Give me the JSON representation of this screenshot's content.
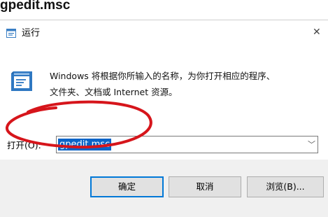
{
  "caption": "gpedit.msc",
  "dialog": {
    "title": "运行",
    "description_line1": "Windows 将根据你所输入的名称，为你打开相应的程序、",
    "description_line2": "文件夹、文档或 Internet 资源。",
    "open_label": "打开(O):",
    "open_value": "gpedit.msc"
  },
  "buttons": {
    "ok": "确定",
    "cancel": "取消",
    "browse": "浏览(B)..."
  },
  "colors": {
    "accent": "#0078d7",
    "selection": "#0a64c8",
    "annotation": "#d6151b"
  },
  "icons": {
    "title": "run-app-icon",
    "dialog": "run-dialog-icon",
    "close": "close-icon",
    "dropdown": "chevron-down-icon"
  }
}
